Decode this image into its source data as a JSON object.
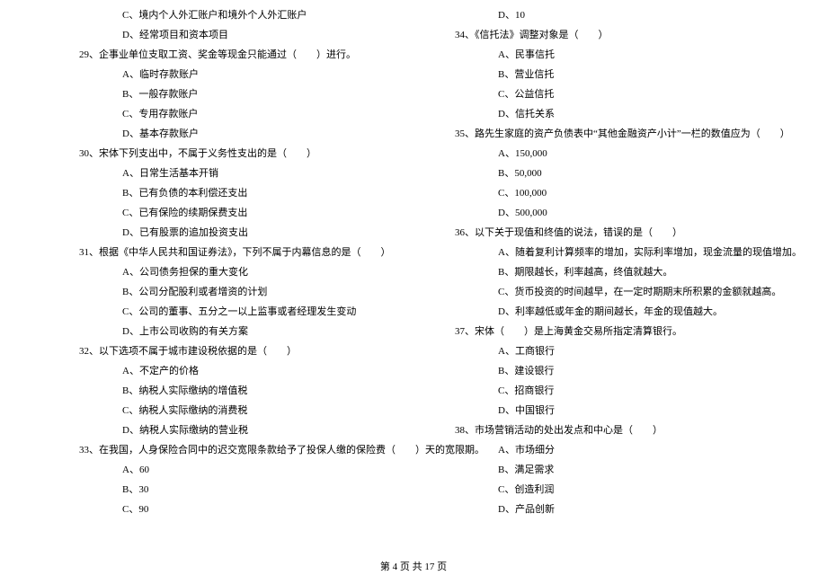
{
  "left": {
    "l1": "C、境内个人外汇账户和境外个人外汇账户",
    "l2": "D、经常项目和资本项目",
    "q29": "29、企事业单位支取工资、奖金等现金只能通过（　　）进行。",
    "q29a": "A、临时存款账户",
    "q29b": "B、一般存款账户",
    "q29c": "C、专用存款账户",
    "q29d": "D、基本存款账户",
    "q30": "30、宋体下列支出中，不属于义务性支出的是（　　）",
    "q30a": "A、日常生活基本开销",
    "q30b": "B、已有负债的本利偿还支出",
    "q30c": "C、已有保险的续期保费支出",
    "q30d": "D、已有股票的追加投资支出",
    "q31": "31、根据《中华人民共和国证券法》，下列不属于内幕信息的是（　　）",
    "q31a": "A、公司债务担保的重大变化",
    "q31b": "B、公司分配股利或者增资的计划",
    "q31c": "C、公司的董事、五分之一以上监事或者经理发生变动",
    "q31d": "D、上市公司收购的有关方案",
    "q32": "32、以下选项不属于城市建设税依据的是（　　）",
    "q32a": "A、不定产的价格",
    "q32b": "B、纳税人实际缴纳的增值税",
    "q32c": "C、纳税人实际缴纳的消费税",
    "q32d": "D、纳税人实际缴纳的营业税",
    "q33": "33、在我国，人身保险合同中的迟交宽限条款给予了投保人缴的保险费（　　）天的宽限期。",
    "q33a": "A、60",
    "q33b": "B、30",
    "q33c": "C、90"
  },
  "right": {
    "r1": "D、10",
    "q34": "34、《信托法》调整对象是（　　）",
    "q34a": "A、民事信托",
    "q34b": "B、营业信托",
    "q34c": "C、公益信托",
    "q34d": "D、信托关系",
    "q35": "35、路先生家庭的资产负债表中“其他金融资产小计”一栏的数值应为（　　）",
    "q35a": "A、150,000",
    "q35b": "B、50,000",
    "q35c": "C、100,000",
    "q35d": "D、500,000",
    "q36": "36、以下关于现值和终值的说法，错误的是（　　）",
    "q36a": "A、随着复利计算频率的增加，实际利率增加，现金流量的现值增加。",
    "q36b": "B、期限越长，利率越高，终值就越大。",
    "q36c": "C、货币投资的时间越早，在一定时期期末所积累的金额就越高。",
    "q36d": "D、利率越低或年金的期间越长，年金的现值越大。",
    "q37": "37、宋体（　　）是上海黄金交易所指定清算银行。",
    "q37a": "A、工商银行",
    "q37b": "B、建设银行",
    "q37c": "C、招商银行",
    "q37d": "D、中国银行",
    "q38": "38、市场营销活动的处出发点和中心是（　　）",
    "q38a": "A、市场细分",
    "q38b": "B、满足需求",
    "q38c": "C、创造利润",
    "q38d": "D、产品创新"
  },
  "footer": "第 4 页 共 17 页"
}
